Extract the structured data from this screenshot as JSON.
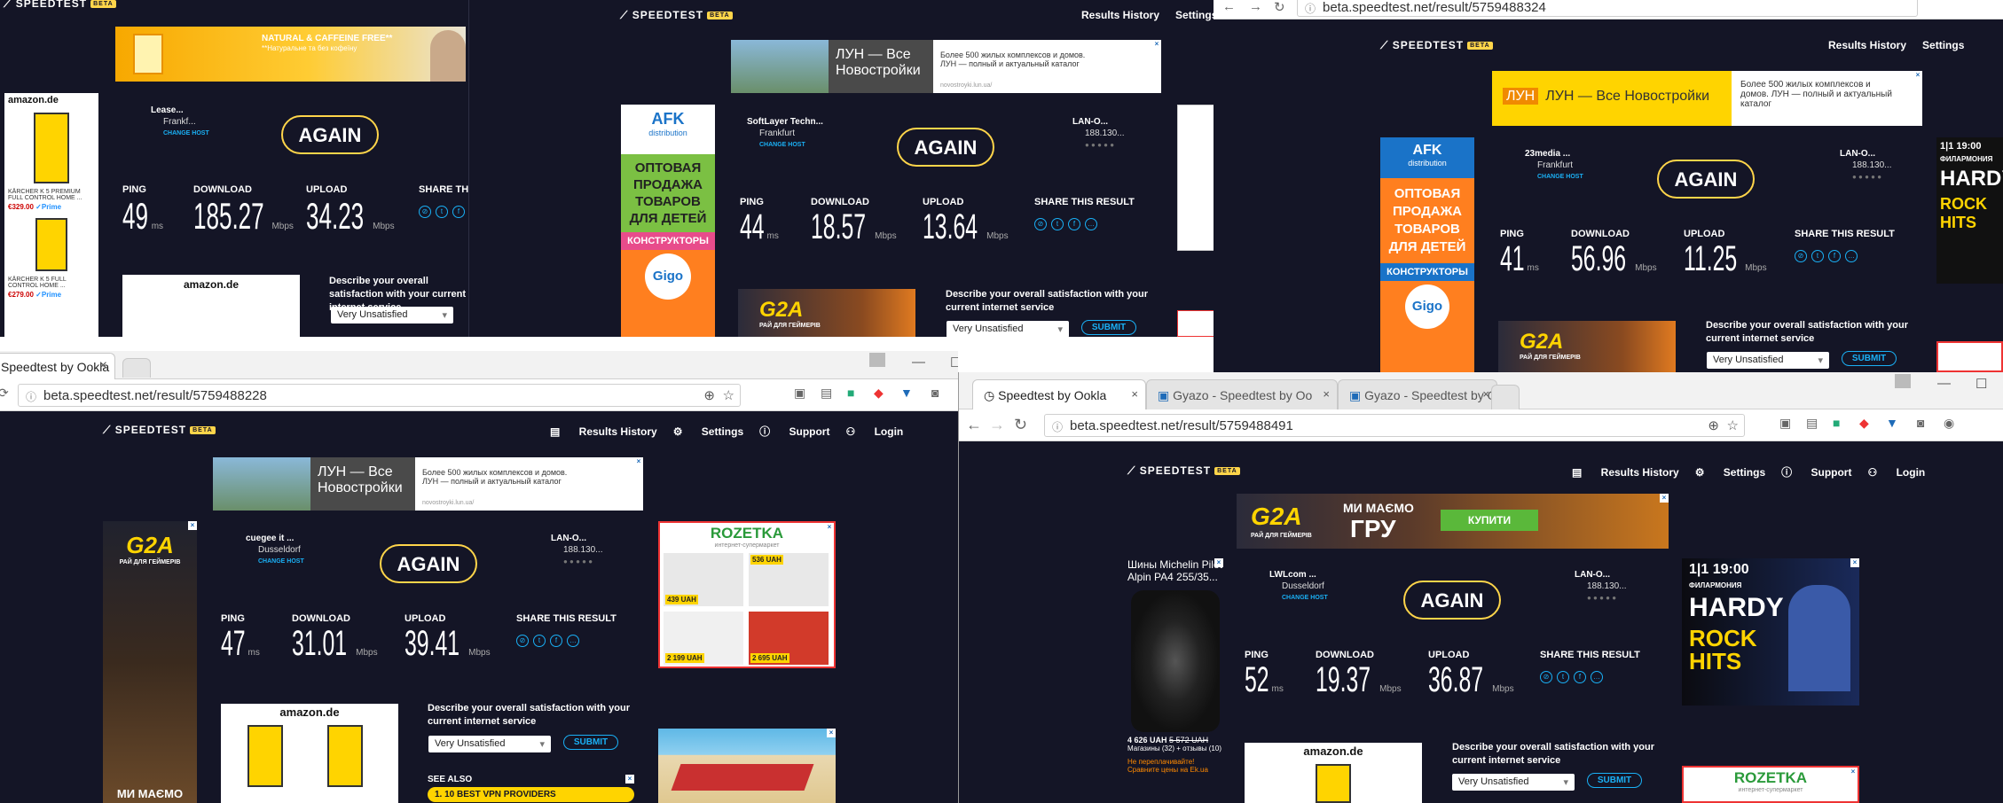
{
  "common": {
    "logo": "SPEEDTEST",
    "beta": "BETA",
    "again": "AGAIN",
    "change_host": "CHANGE HOST",
    "ping": "PING",
    "download": "DOWNLOAD",
    "upload": "UPLOAD",
    "share": "SHARE THIS RESULT",
    "ms": "ms",
    "mbps": "Mbps",
    "survey": "Describe your overall satisfaction with your current internet service",
    "select_value": "Very Unsatisfied",
    "submit": "SUBMIT",
    "results_history": "Results History",
    "settings": "Settings",
    "support": "Support",
    "login": "Login",
    "lan": "LAN-O...",
    "ip": "188.130...",
    "close": "×"
  },
  "w1": {
    "host": "Lease...",
    "city": "Frankf...",
    "ping": "49",
    "download": "185.27",
    "upload": "34.23",
    "ad_top": "NATURAL & CAFFEINE FREE**",
    "ad_top2": "**Натуральне та без кофеїну",
    "amazon": "amazon.de",
    "k1": "KÄRCHER K 5 PREMIUM FULL CONTROL HOME ...",
    "p1": "€329.00",
    "k2": "KÄRCHER K 5 FULL CONTROL HOME ...",
    "p2": "€279.00",
    "prime": "✓Prime"
  },
  "w2": {
    "host": "SoftLayer Techn...",
    "city": "Frankfurt",
    "ping": "44",
    "download": "18.57",
    "upload": "13.64",
    "lun": "ЛУН — Все Новостройки",
    "lun_sub": "Более 500 жилых комплексов и домов. ЛУН — полный и актуальный каталог",
    "lun_url": "novostroyki.lun.ua/",
    "afk": "AFK",
    "afk_sub": "distribution",
    "opt": "ОПТОВАЯ ПРОДАЖА ТОВАРОВ ДЛЯ ДЕТЕЙ",
    "konstr": "КОНСТРУКТОРЫ",
    "gigo": "Gigo",
    "g2a": "G2A",
    "g2a_sub": "РАЙ ДЛЯ ГЕЙМЕРІВ"
  },
  "w3": {
    "url": "beta.speedtest.net/result/5759488324",
    "host": "23media ...",
    "city": "Frankfurt",
    "ping": "41",
    "download": "56.96",
    "upload": "11.25",
    "lun_logo": "ЛУН",
    "lun": "ЛУН — Все Новостройки",
    "lun_sub": "Более 500 жилых комплексов и домов. ЛУН — полный и актуальный каталог",
    "fil_date": "1|1  19:00",
    "fil": "ФИЛАРМОНИЯ",
    "hardy": "HARDY",
    "rock": "ROCK HITS"
  },
  "w4": {
    "tab": "Speedtest by Ookla",
    "url": "beta.speedtest.net/result/5759488228",
    "host": "cuegee it ...",
    "city": "Dusseldorf",
    "ping": "47",
    "download": "31.01",
    "upload": "39.41",
    "rozetka": "ROZETKA",
    "rozetka_sub": "интернет-супермаркет",
    "r1": "439 UAH",
    "r2": "536 UAH",
    "r3": "2 199 UAH",
    "r4": "2 695 UAH",
    "see_also": "SEE ALSO",
    "vpn": "1. 10 BEST VPN PROVIDERS",
    "mi": "МИ МАЄМО"
  },
  "w5": {
    "tab1": "Speedtest by Ookla",
    "tab2": "Gyazo - Speedtest by Oo",
    "tab3": "Gyazo - Speedtest by Oo",
    "url": "beta.speedtest.net/result/5759488491",
    "host": "LWLcom ...",
    "city": "Dusseldorf",
    "ping": "52",
    "download": "19.37",
    "upload": "36.87",
    "g2a_title": "МИ МАЄМО",
    "g2a_title2": "ГРУ",
    "buy": "КУПИТИ",
    "tire_title": "Шины Michelin Pilot Alpin PA4 255/35...",
    "tire_price": "4 626 UAH",
    "tire_old": "5 572 UAH",
    "tire_shops": "Магазины (32) + отзывы (10)",
    "tire_note": "Не переплачивайте! Сравните цены на Ek.ua"
  }
}
